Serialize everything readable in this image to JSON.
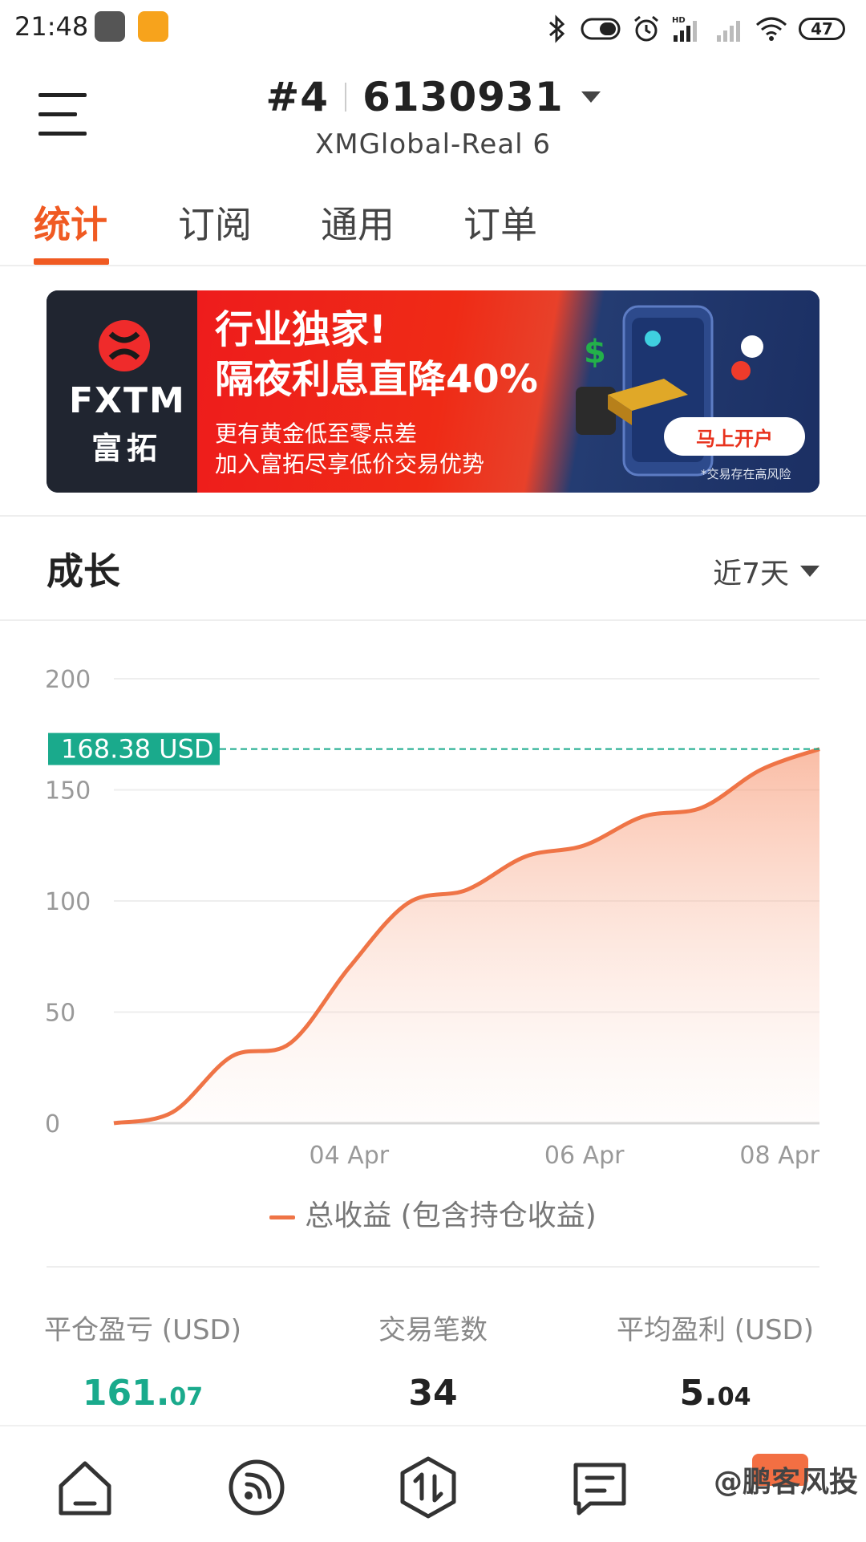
{
  "status_bar": {
    "time": "21:48",
    "battery": "47",
    "icons": [
      "bluetooth-icon",
      "toggle-icon",
      "alarm-icon",
      "hd-signal-icon",
      "signal-icon",
      "wifi-icon",
      "battery-icon"
    ]
  },
  "header": {
    "account_prefix": "#4",
    "account_number": "6130931",
    "server": "XMGlobal-Real 6"
  },
  "tabs": [
    {
      "label": "统计",
      "active": true
    },
    {
      "label": "订阅",
      "active": false
    },
    {
      "label": "通用",
      "active": false
    },
    {
      "label": "订单",
      "active": false
    }
  ],
  "banner": {
    "brand_en": "FXTM",
    "brand_cn": "富拓",
    "headline_1": "行业独家!",
    "headline_2": "隔夜利息直降40%",
    "sub_1": "更有黄金低至零点差",
    "sub_2": "加入富拓尽享低价交易优势",
    "cta": "马上开户",
    "risk_note": "*交易存在高风险"
  },
  "growth": {
    "title": "成长",
    "range": "近7天"
  },
  "chart_data": {
    "type": "area",
    "x": [
      "2024-04-02",
      "2024-04-02T12",
      "2024-04-03",
      "2024-04-03T12",
      "2024-04-04",
      "2024-04-04T12",
      "2024-04-05",
      "2024-04-05T12",
      "2024-04-06",
      "2024-04-06T12",
      "2024-04-07",
      "2024-04-07T12",
      "2024-04-08"
    ],
    "x_ticks": [
      "04 Apr",
      "06 Apr",
      "08 Apr"
    ],
    "y_ticks": [
      "0",
      "50",
      "100",
      "150",
      "200"
    ],
    "ylim": [
      0,
      200
    ],
    "series": [
      {
        "name": "总收益 (包含持仓收益)",
        "values": [
          0,
          5,
          30,
          36,
          70,
          99,
          105,
          120,
          125,
          138,
          142,
          159,
          168.38
        ]
      }
    ],
    "current_value_label": "168.38 USD",
    "line_color": "#ef7446",
    "marker_color": "#1aaa8c",
    "grid": true
  },
  "legend": {
    "label": "总收益 (包含持仓收益)"
  },
  "stats": {
    "closed_pl": {
      "label": "平仓盈亏 (USD)",
      "int": "161.",
      "dec": "07"
    },
    "trades": {
      "label": "交易笔数",
      "value": "34"
    },
    "avg_profit": {
      "label": "平均盈利 (USD)",
      "int": "5.",
      "dec": "04"
    }
  },
  "bottom_nav": [
    "home-icon",
    "signal-feed-icon",
    "trade-icon",
    "messages-icon",
    "calendar-icon"
  ],
  "watermark": "@鹏客风投"
}
